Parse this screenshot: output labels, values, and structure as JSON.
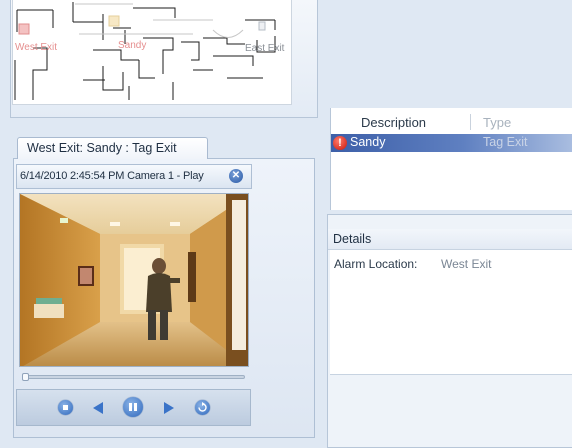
{
  "map": {
    "labels": {
      "west_exit": "West Exit",
      "sandy": "Sandy",
      "east_exit": "East Exit"
    }
  },
  "camera": {
    "tab_label": "West Exit:  Sandy : Tag Exit",
    "status_text": "6/14/2010 2:45:54 PM Camera 1 - Play",
    "seek_progress": 0.0,
    "controls": [
      "stop-icon",
      "step-back-icon",
      "pause-icon",
      "play-icon",
      "loop-icon"
    ]
  },
  "events": {
    "columns": {
      "description": "Description",
      "type": "Type"
    },
    "rows": [
      {
        "description": "Sandy",
        "type": "Tag Exit",
        "icon": "alert-icon",
        "selected": true
      }
    ]
  },
  "details": {
    "title": "Details",
    "alarm_location_label": "Alarm Location:",
    "alarm_location_value": "West Exit"
  },
  "colors": {
    "selection": "#3d5fa8",
    "alert": "#d0200f",
    "accent_button": "#2f68bd"
  }
}
